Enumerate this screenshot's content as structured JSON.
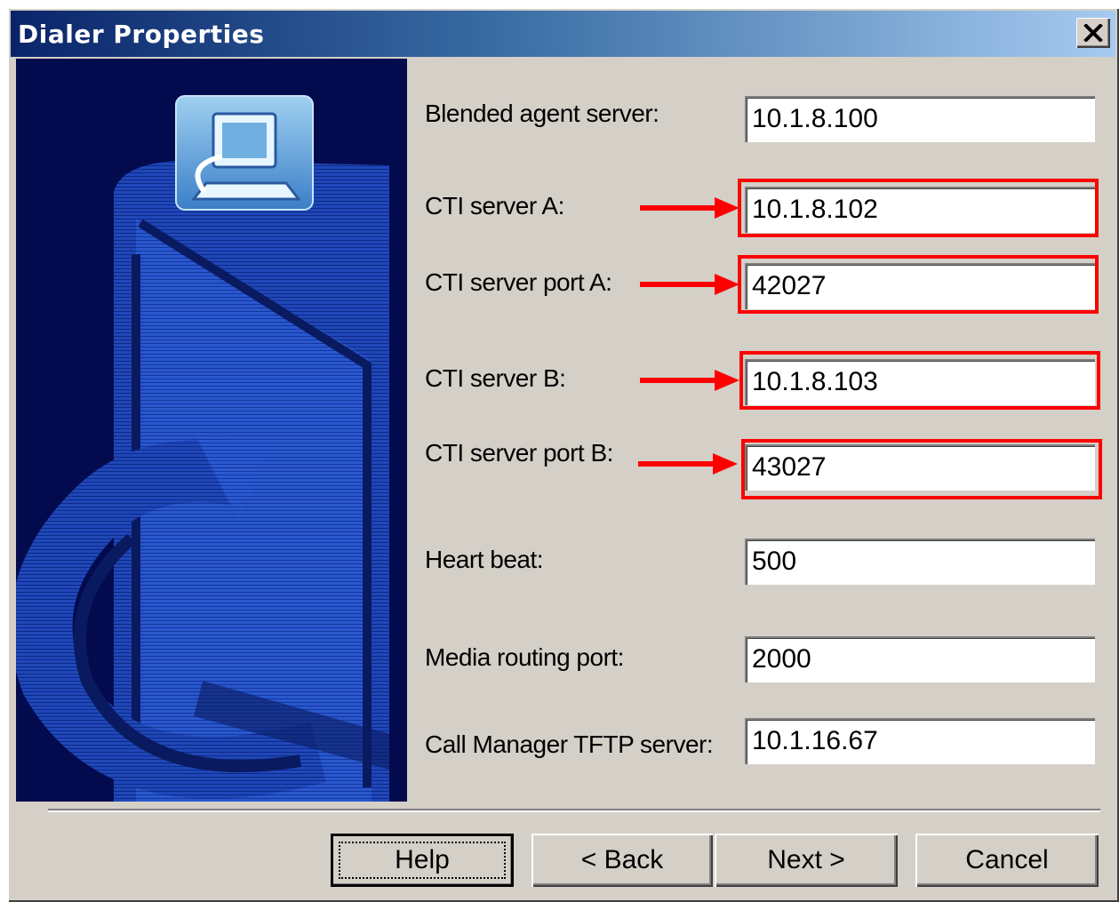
{
  "dialog": {
    "title": "Dialer Properties"
  },
  "fields": [
    {
      "label": "Blended agent server:",
      "value": "10.1.8.100"
    },
    {
      "label": "CTI server A:",
      "value": "10.1.8.102"
    },
    {
      "label": "CTI server port A:",
      "value": "42027"
    },
    {
      "label": "CTI server B:",
      "value": "10.1.8.103"
    },
    {
      "label": "CTI server port B:",
      "value": "43027"
    },
    {
      "label": "Heart beat:",
      "value": "500"
    },
    {
      "label": "Media routing port:",
      "value": "2000"
    },
    {
      "label": "Call Manager TFTP server:",
      "value": "10.1.16.67"
    }
  ],
  "buttons": {
    "help": "Help",
    "back": "< Back",
    "next": "Next >",
    "cancel": "Cancel"
  },
  "icons": {
    "close": "close-icon",
    "wizard": "computer-icon",
    "annotation": "red-arrow-icon"
  },
  "colors": {
    "title_gradient_start": "#0a246a",
    "title_gradient_end": "#a6caf0",
    "dialog_face": "#d4d0c8",
    "side_panel": "#030b4e",
    "annotation": "#ff0000"
  }
}
